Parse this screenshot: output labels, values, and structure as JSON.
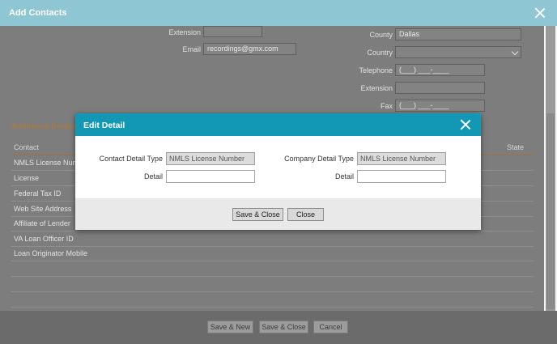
{
  "window": {
    "title": "Add Contacts"
  },
  "form": {
    "extension_top": {
      "label": "Extension",
      "value": ""
    },
    "email": {
      "label": "Email",
      "value": "recordings@gmx.com"
    },
    "county": {
      "label": "County",
      "value": "Dallas"
    },
    "country": {
      "label": "Country",
      "value": ""
    },
    "telephone": {
      "label": "Telephone",
      "value": "(___) ___-____"
    },
    "extension_right": {
      "label": "Extension",
      "value": ""
    },
    "fax": {
      "label": "Fax",
      "value": "(___) ___-____"
    }
  },
  "details_section": {
    "title": "Additional Details",
    "columns": [
      "Contact",
      "State"
    ],
    "rows": [
      "NMLS License Number",
      "License",
      "Federal Tax ID",
      "Web Site Address",
      "Affiliate of Lender",
      "VA Loan Officer ID",
      "Loan Originator Mobile",
      "",
      "",
      ""
    ]
  },
  "footer": {
    "save_new": "Save & New",
    "save_close": "Save & Close",
    "cancel": "Cancel"
  },
  "modal": {
    "title": "Edit Detail",
    "contact_detail_type": {
      "label": "Contact Detail Type",
      "value": "NMLS License Number"
    },
    "contact_detail": {
      "label": "Detail",
      "value": ""
    },
    "company_detail_type": {
      "label": "Company Detail Type",
      "value": "NMLS License Number"
    },
    "company_detail": {
      "label": "Detail",
      "value": ""
    },
    "save_close": "Save & Close",
    "close": "Close"
  },
  "colors": {
    "modal_header": "#1297b5",
    "section_title": "#a57a44",
    "window_header": "#8fc6d3"
  }
}
